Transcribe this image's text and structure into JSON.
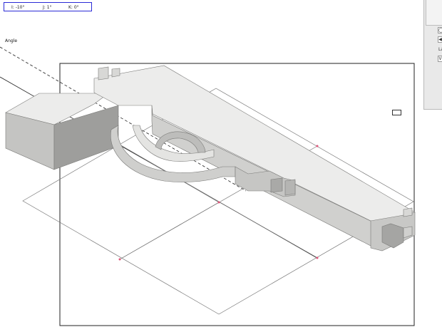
{
  "readout": {
    "i": "I: -10°",
    "j": "J: 1°",
    "k": "K: 0°"
  },
  "angle_label": "Angle",
  "panel": {
    "row1_glyph": "◯",
    "row2_glyph": "◀",
    "row3_text": "La",
    "row4_glyph": "V"
  },
  "colors": {
    "readout_border": "#2b2bd6",
    "grid_marker": "#e0557a",
    "model_face_top": "#ececeb",
    "model_face_side": "#c4c4c2",
    "model_face_dark": "#9a9a98"
  }
}
